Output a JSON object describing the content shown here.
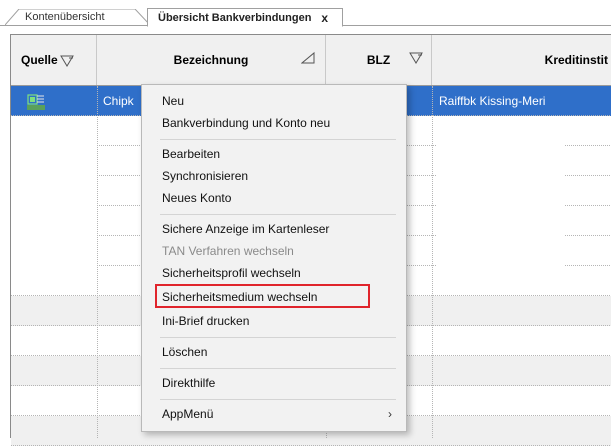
{
  "tabs": [
    {
      "label": "Kontenübersicht",
      "active": false
    },
    {
      "label": "Übersicht Bankverbindungen",
      "active": true,
      "close": "x"
    }
  ],
  "columns": [
    {
      "label": "Quelle"
    },
    {
      "label": "Bezeichnung"
    },
    {
      "label": "BLZ"
    },
    {
      "label": "Kreditinstit"
    }
  ],
  "selected_row": {
    "source_icon": "chipcard-icon",
    "name": "Chipk",
    "bank": "Raiffbk Kissing-Meri"
  },
  "context_menu": {
    "items": [
      {
        "label": "Neu"
      },
      {
        "label": "Bankverbindung und Konto neu"
      },
      {
        "label": "Bearbeiten"
      },
      {
        "label": "Synchronisieren"
      },
      {
        "label": "Neues Konto"
      },
      {
        "label": "Sichere Anzeige im Kartenleser"
      },
      {
        "label": "TAN Verfahren wechseln",
        "disabled": true
      },
      {
        "label": "Sicherheitsprofil wechseln"
      },
      {
        "label": "Sicherheitsmedium wechseln",
        "highlighted": true
      },
      {
        "label": "Ini-Brief drucken"
      },
      {
        "label": "Löschen"
      },
      {
        "label": "Direkthilfe"
      },
      {
        "label": "AppMenü",
        "submenu_arrow": "›"
      }
    ]
  },
  "colors": {
    "selection": "#2f6fc9",
    "highlight_box": "#e0242c",
    "alt_row": "#f0f0f0"
  }
}
